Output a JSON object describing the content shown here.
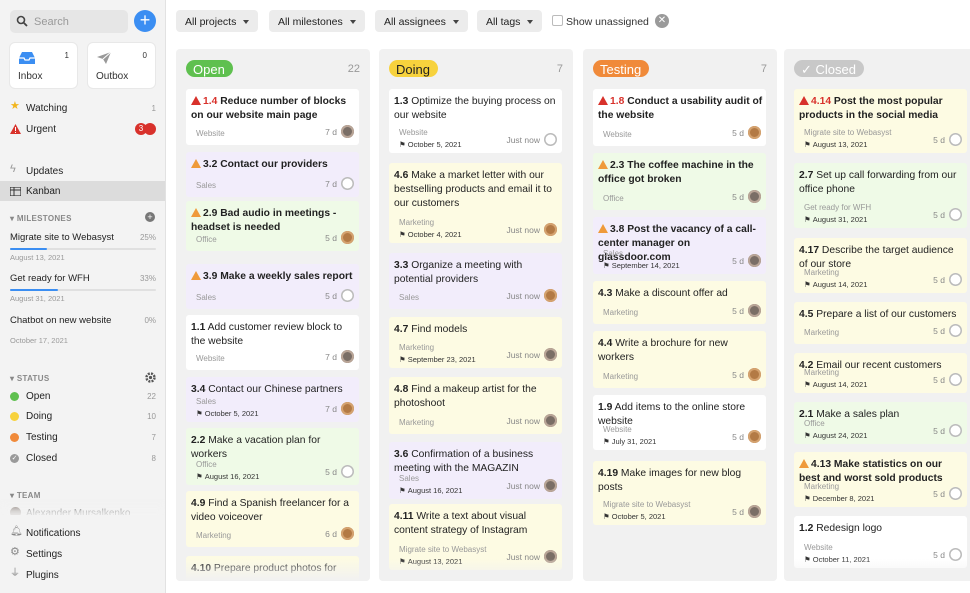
{
  "sidebar": {
    "search_placeholder": "Search",
    "add_label": "+",
    "inbox": {
      "label": "Inbox",
      "count": "1"
    },
    "outbox": {
      "label": "Outbox",
      "count": "0"
    },
    "nav": [
      {
        "label": "Watching",
        "count": "1",
        "icon": "star-icon"
      },
      {
        "label": "Urgent",
        "count": "3",
        "icon": "warning-icon"
      },
      {
        "label": "Updates",
        "count": "",
        "icon": "bolt-icon"
      },
      {
        "label": "Kanban",
        "count": "",
        "icon": "kanban-icon"
      }
    ],
    "milestones_header": "MILESTONES",
    "milestones": [
      {
        "name": "Migrate site to Webasyst",
        "pct": "25%",
        "date": "August 13, 2021",
        "progress": 0.25
      },
      {
        "name": "Get ready for WFH",
        "pct": "33%",
        "date": "August 31, 2021",
        "progress": 0.33
      },
      {
        "name": "Chatbot on new website",
        "pct": "0%",
        "date": "October 17, 2021",
        "progress": 0
      }
    ],
    "status_header": "STATUS",
    "statuses": [
      {
        "label": "Open",
        "count": "22",
        "color": "#5fc04f"
      },
      {
        "label": "Doing",
        "count": "10",
        "color": "#f7d23d"
      },
      {
        "label": "Testing",
        "count": "7",
        "color": "#f08a3a"
      },
      {
        "label": "Closed",
        "count": "8",
        "color": "#9a9a9a"
      }
    ],
    "team_header": "TEAM",
    "team_member": "Alexander Mursalkenko",
    "bottom": [
      {
        "label": "Notifications",
        "icon": "bell-icon"
      },
      {
        "label": "Settings",
        "icon": "gear-icon"
      },
      {
        "label": "Plugins",
        "icon": "plug-icon"
      }
    ]
  },
  "filters": {
    "projects": "All projects",
    "milestones": "All milestones",
    "assignees": "All assignees",
    "tags": "All tags",
    "show_unassigned": "Show unassigned"
  },
  "columns": [
    {
      "name": "Open",
      "count": "22",
      "cards": [
        {
          "num": "1.4",
          "title": "Reduce number of blocks on our website main page",
          "milestone": "Website",
          "date": "",
          "age": "7 d",
          "avatar": "photo",
          "color": "white",
          "warn": "red",
          "bold": true
        },
        {
          "num": "3.2",
          "title": "Contact our providers",
          "milestone": "Sales",
          "date": "",
          "age": "7 d",
          "avatar": "empty",
          "color": "purple",
          "warn": "orange",
          "bold": true
        },
        {
          "num": "2.9",
          "title": "Bad audio in meetings - headset is needed",
          "milestone": "Office",
          "date": "",
          "age": "5 d",
          "avatar": "brown",
          "color": "green",
          "warn": "orange",
          "bold": true
        },
        {
          "num": "3.9",
          "title": "Make a weekly sales report",
          "milestone": "Sales",
          "date": "",
          "age": "5 d",
          "avatar": "empty",
          "color": "purple",
          "warn": "orange",
          "bold": true
        },
        {
          "num": "1.1",
          "title": "Add customer review block to the website",
          "milestone": "Website",
          "date": "",
          "age": "7 d",
          "avatar": "photo",
          "color": "white",
          "warn": "",
          "bold": false
        },
        {
          "num": "3.4",
          "title": "Contact our Chinese partners",
          "milestone": "Sales",
          "date": "October 5, 2021",
          "age": "7 d",
          "avatar": "brown",
          "color": "purple",
          "warn": "",
          "bold": false
        },
        {
          "num": "2.2",
          "title": "Make a vacation plan for workers",
          "milestone": "Office",
          "date": "August 16, 2021",
          "age": "5 d",
          "avatar": "empty",
          "color": "green",
          "warn": "",
          "bold": false
        },
        {
          "num": "4.9",
          "title": "Find a Spanish freelancer for a video voiceover",
          "milestone": "Marketing",
          "date": "",
          "age": "6 d",
          "avatar": "brown",
          "color": "yellow",
          "warn": "",
          "bold": false
        },
        {
          "num": "4.10",
          "title": "Prepare product photos for",
          "milestone": "",
          "date": "",
          "age": "",
          "avatar": "none",
          "color": "yellow",
          "warn": "",
          "bold": false
        }
      ]
    },
    {
      "name": "Doing",
      "count": "7",
      "cards": [
        {
          "num": "1.3",
          "title": "Optimize the buying process on our website",
          "milestone": "Website",
          "date": "October 5, 2021",
          "age": "Just now",
          "avatar": "empty",
          "color": "white",
          "warn": "",
          "bold": false
        },
        {
          "num": "4.6",
          "title": "Make a market letter with our bestselling products and email it to our customers",
          "milestone": "Marketing",
          "date": "October 4, 2021",
          "age": "Just now",
          "avatar": "brown",
          "color": "yellow",
          "warn": "",
          "bold": false
        },
        {
          "num": "3.3",
          "title": "Organize a meeting with potential providers",
          "milestone": "Sales",
          "date": "",
          "age": "Just now",
          "avatar": "brown",
          "color": "purple",
          "warn": "",
          "bold": false
        },
        {
          "num": "4.7",
          "title": "Find models",
          "milestone": "Marketing",
          "date": "September 23, 2021",
          "age": "Just now",
          "avatar": "photo",
          "color": "yellow",
          "warn": "",
          "bold": false
        },
        {
          "num": "4.8",
          "title": "Find a makeup artist for the photoshoot",
          "milestone": "Marketing",
          "date": "",
          "age": "Just now",
          "avatar": "photo",
          "color": "yellow",
          "warn": "",
          "bold": false
        },
        {
          "num": "3.6",
          "title": "Confirmation of a business meeting with the MAGAZIN",
          "milestone": "Sales",
          "date": "August 16, 2021",
          "age": "Just now",
          "avatar": "photo",
          "color": "purple",
          "warn": "",
          "bold": false
        },
        {
          "num": "4.11",
          "title": "Write a text about visual content strategy of Instagram",
          "milestone": "Migrate site to Webasyst",
          "date": "August 13, 2021",
          "age": "Just now",
          "avatar": "photo",
          "color": "yellow",
          "warn": "",
          "bold": false
        }
      ]
    },
    {
      "name": "Testing",
      "count": "7",
      "cards": [
        {
          "num": "1.8",
          "title": "Conduct a usability audit of the website",
          "milestone": "Website",
          "date": "",
          "age": "5 d",
          "avatar": "brown",
          "color": "white",
          "warn": "red",
          "bold": true
        },
        {
          "num": "2.3",
          "title": "The coffee machine in the office got broken",
          "milestone": "Office",
          "date": "",
          "age": "5 d",
          "avatar": "photo",
          "color": "green",
          "warn": "orange",
          "bold": true
        },
        {
          "num": "3.8",
          "title": "Post the vacancy of a call-center manager on glassdoor.com",
          "milestone": "Sales",
          "date": "September 14, 2021",
          "age": "5 d",
          "avatar": "photo",
          "color": "purple",
          "warn": "orange",
          "bold": true
        },
        {
          "num": "4.3",
          "title": "Make a discount offer ad",
          "milestone": "Marketing",
          "date": "",
          "age": "5 d",
          "avatar": "photo",
          "color": "yellow",
          "warn": "",
          "bold": false
        },
        {
          "num": "4.4",
          "title": "Write a brochure for new workers",
          "milestone": "Marketing",
          "date": "",
          "age": "5 d",
          "avatar": "brown",
          "color": "yellow",
          "warn": "",
          "bold": false
        },
        {
          "num": "1.9",
          "title": "Add items to the online store website",
          "milestone": "Website",
          "date": "July 31, 2021",
          "age": "5 d",
          "avatar": "brown",
          "color": "white",
          "warn": "",
          "bold": false
        },
        {
          "num": "4.19",
          "title": "Make images for new blog posts",
          "milestone": "Migrate site to Webasyst",
          "date": "October 5, 2021",
          "age": "5 d",
          "avatar": "photo",
          "color": "yellow",
          "warn": "",
          "bold": false
        }
      ]
    },
    {
      "name": "Closed",
      "count": "",
      "cards": [
        {
          "num": "4.14",
          "title": "Post the most popular products in the social media",
          "milestone": "Migrate site to Webasyst",
          "date": "August 13, 2021",
          "age": "5 d",
          "avatar": "empty",
          "color": "yellow",
          "warn": "red",
          "bold": true
        },
        {
          "num": "2.7",
          "title": "Set up call forwarding from our office phone",
          "milestone": "Get ready for WFH",
          "date": "August 31, 2021",
          "age": "5 d",
          "avatar": "empty",
          "color": "green",
          "warn": "",
          "bold": false
        },
        {
          "num": "4.17",
          "title": "Describe the target audience of our store",
          "milestone": "Marketing",
          "date": "August 14, 2021",
          "age": "5 d",
          "avatar": "empty",
          "color": "yellow",
          "warn": "",
          "bold": false
        },
        {
          "num": "4.5",
          "title": "Prepare a list of our customers",
          "milestone": "Marketing",
          "date": "",
          "age": "5 d",
          "avatar": "empty",
          "color": "yellow",
          "warn": "",
          "bold": false
        },
        {
          "num": "4.2",
          "title": "Email our recent customers",
          "milestone": "Marketing",
          "date": "August 14, 2021",
          "age": "5 d",
          "avatar": "empty",
          "color": "yellow",
          "warn": "",
          "bold": false
        },
        {
          "num": "2.1",
          "title": "Make a sales plan",
          "milestone": "Office",
          "date": "August 24, 2021",
          "age": "5 d",
          "avatar": "empty",
          "color": "green",
          "warn": "",
          "bold": false
        },
        {
          "num": "4.13",
          "title": "Make statistics on our best and worst sold products",
          "milestone": "Marketing",
          "date": "December 8, 2021",
          "age": "5 d",
          "avatar": "empty",
          "color": "yellow",
          "warn": "orange",
          "bold": true
        },
        {
          "num": "1.2",
          "title": "Redesign logo",
          "milestone": "Website",
          "date": "October 11, 2021",
          "age": "5 d",
          "avatar": "empty",
          "color": "white",
          "warn": "",
          "bold": false
        }
      ]
    }
  ]
}
